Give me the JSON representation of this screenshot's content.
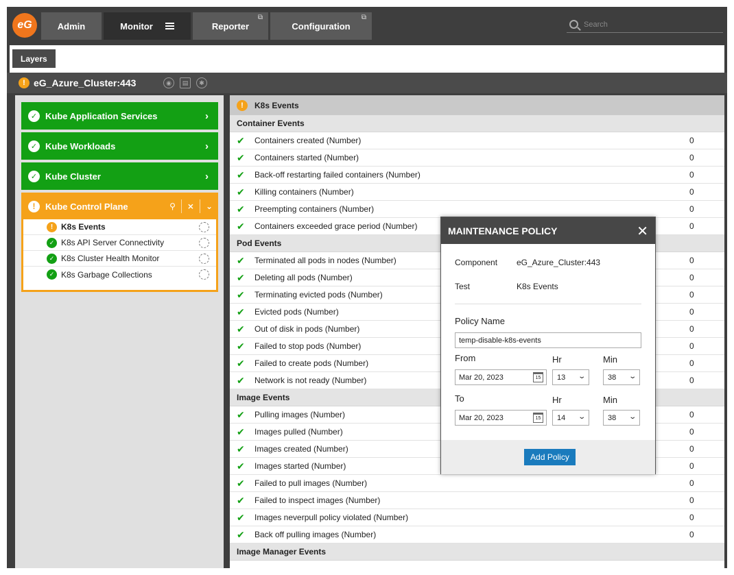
{
  "nav": {
    "logo_text": "eG",
    "items": [
      {
        "label": "Admin"
      },
      {
        "label": "Monitor"
      },
      {
        "label": "Reporter"
      },
      {
        "label": "Configuration"
      }
    ],
    "search_placeholder": "Search"
  },
  "layers_button": "Layers",
  "component": {
    "name": "eG_Azure_Cluster:443",
    "status_icon": "warning-icon"
  },
  "layers": [
    {
      "label": "Kube Application Services",
      "status": "ok"
    },
    {
      "label": "Kube Workloads",
      "status": "ok"
    },
    {
      "label": "Kube Cluster",
      "status": "ok"
    },
    {
      "label": "Kube Control Plane",
      "status": "warning"
    }
  ],
  "tests": [
    {
      "label": "K8s Events",
      "status": "warning"
    },
    {
      "label": "K8s API Server Connectivity",
      "status": "ok"
    },
    {
      "label": "K8s Cluster Health Monitor",
      "status": "ok"
    },
    {
      "label": "K8s Garbage Collections",
      "status": "ok"
    }
  ],
  "main": {
    "title": "K8s Events",
    "groups": [
      {
        "name": "Container Events",
        "rows": [
          {
            "label": "Containers created (Number)",
            "value": "0"
          },
          {
            "label": "Containers started (Number)",
            "value": "0"
          },
          {
            "label": "Back-off restarting failed containers (Number)",
            "value": "0"
          },
          {
            "label": "Killing containers (Number)",
            "value": "0"
          },
          {
            "label": "Preempting containers (Number)",
            "value": "0"
          },
          {
            "label": "Containers exceeded grace period (Number)",
            "value": "0"
          }
        ]
      },
      {
        "name": "Pod Events",
        "rows": [
          {
            "label": "Terminated all pods in nodes (Number)",
            "value": "0"
          },
          {
            "label": "Deleting all pods (Number)",
            "value": "0"
          },
          {
            "label": "Terminating evicted pods (Number)",
            "value": "0"
          },
          {
            "label": "Evicted pods (Number)",
            "value": "0"
          },
          {
            "label": "Out of disk in pods (Number)",
            "value": "0"
          },
          {
            "label": "Failed to stop pods (Number)",
            "value": "0"
          },
          {
            "label": "Failed to create pods (Number)",
            "value": "0"
          },
          {
            "label": "Network is not ready (Number)",
            "value": "0"
          }
        ]
      },
      {
        "name": "Image Events",
        "rows": [
          {
            "label": "Pulling images (Number)",
            "value": "0"
          },
          {
            "label": "Images pulled (Number)",
            "value": "0"
          },
          {
            "label": "Images created (Number)",
            "value": "0"
          },
          {
            "label": "Images started (Number)",
            "value": "0"
          },
          {
            "label": "Failed to pull images (Number)",
            "value": "0"
          },
          {
            "label": "Failed to inspect images (Number)",
            "value": "0"
          },
          {
            "label": "Images neverpull policy violated (Number)",
            "value": "0"
          },
          {
            "label": "Back off pulling images (Number)",
            "value": "0"
          }
        ]
      },
      {
        "name": "Image Manager Events",
        "rows": []
      }
    ]
  },
  "modal": {
    "title": "MAINTENANCE POLICY",
    "component_label": "Component",
    "component_value": "eG_Azure_Cluster:443",
    "test_label": "Test",
    "test_value": "K8s Events",
    "policy_name_label": "Policy Name",
    "policy_name_value": "temp-disable-k8s-events",
    "from_label": "From",
    "to_label": "To",
    "hr_label": "Hr",
    "min_label": "Min",
    "from_date": "Mar 20, 2023",
    "from_hr": "13",
    "from_min": "38",
    "to_date": "Mar 20, 2023",
    "to_hr": "14",
    "to_min": "38",
    "calendar_day": "15",
    "add_button": "Add Policy"
  }
}
